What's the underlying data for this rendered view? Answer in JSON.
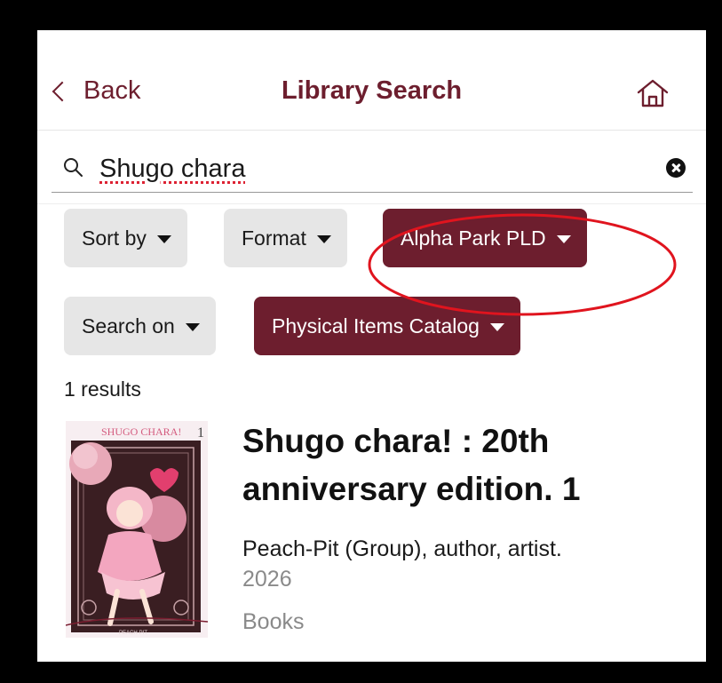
{
  "nav": {
    "back_label": "Back",
    "title": "Library Search"
  },
  "search": {
    "query": "Shugo chara"
  },
  "filters": {
    "sort_label": "Sort by",
    "format_label": "Format",
    "library_label": "Alpha Park PLD",
    "search_on_label": "Search on",
    "catalog_label": "Physical Items Catalog"
  },
  "results": {
    "count_text": "1 results",
    "items": [
      {
        "title": "Shugo chara! : 20th anniversary edition. 1",
        "author": "Peach-Pit (Group), author, artist.",
        "year": "2026",
        "format": "Books",
        "cover_title": "SHUGO CHARA!",
        "cover_volume": "1",
        "cover_publisher": "PEACH-PIT"
      }
    ]
  },
  "colors": {
    "brand": "#6d1e2e",
    "chip_grey": "#e6e6e6",
    "annotation": "#e0141e"
  },
  "icons": {
    "home": "home-icon",
    "search": "search-icon",
    "clear": "clear-search-icon",
    "back": "chevron-left-icon",
    "dropdown": "caret-down-icon"
  }
}
